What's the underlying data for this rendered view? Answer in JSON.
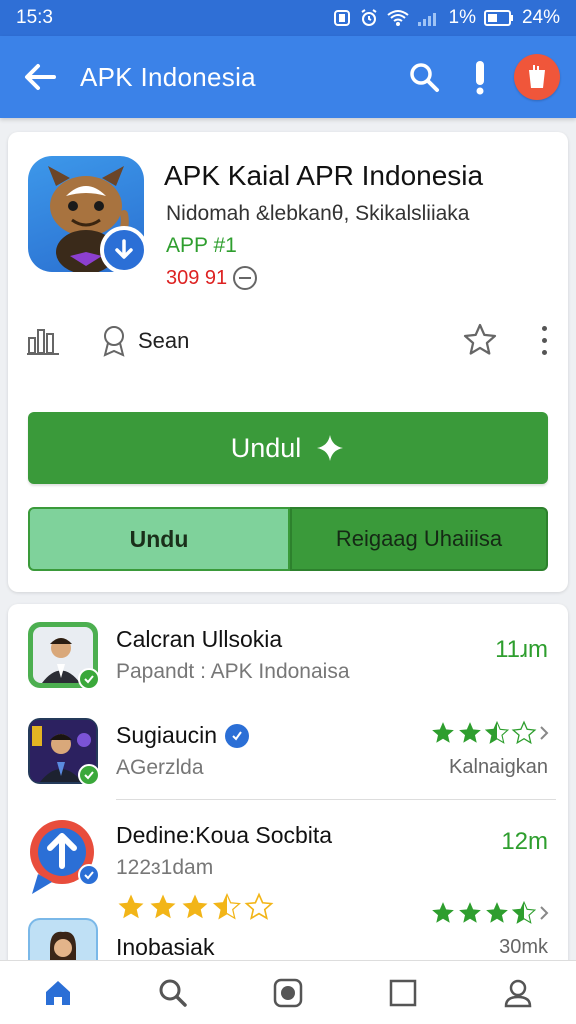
{
  "status": {
    "time": "15:3",
    "battery_text": "1%",
    "battery_pct": "24%"
  },
  "appbar": {
    "title": "APK Indonesia"
  },
  "app": {
    "name": "APK Kaial APR Indonesia",
    "developer": "Nidomah &lebkanθ, Skikalsliiaka",
    "badge": "APP #1",
    "stat": "309 91",
    "author": "Sean",
    "download_label": "Undul",
    "split_left_label": "Undu",
    "split_right_label": "Reigaag Uhaiiisa"
  },
  "list": [
    {
      "title": "Calcran Ullsokia",
      "subtitle": "Papandt : APK Indonaisa",
      "right": "11ɹm",
      "right_sub": ""
    },
    {
      "title": "Sugiaucin",
      "subtitle": "AGerzlda",
      "right": "",
      "right_sub": "Kalnaigkan",
      "rating": 2.5
    },
    {
      "title": "Dedine:Koua Socbita",
      "subtitle": "122ɜ1dam",
      "right": "12m",
      "right_sub": ""
    },
    {
      "title": "Inobasiak",
      "subtitle": "",
      "right": "",
      "right_sub": "30mk",
      "rating": 3.5,
      "left_rating": 3.5
    }
  ],
  "colors": {
    "primary": "#3b82e8",
    "accent_green": "#3a9a3a",
    "profile_red": "#f0563a"
  },
  "nav": [
    "home-icon",
    "search-icon",
    "record-icon",
    "square-icon",
    "person-icon"
  ]
}
